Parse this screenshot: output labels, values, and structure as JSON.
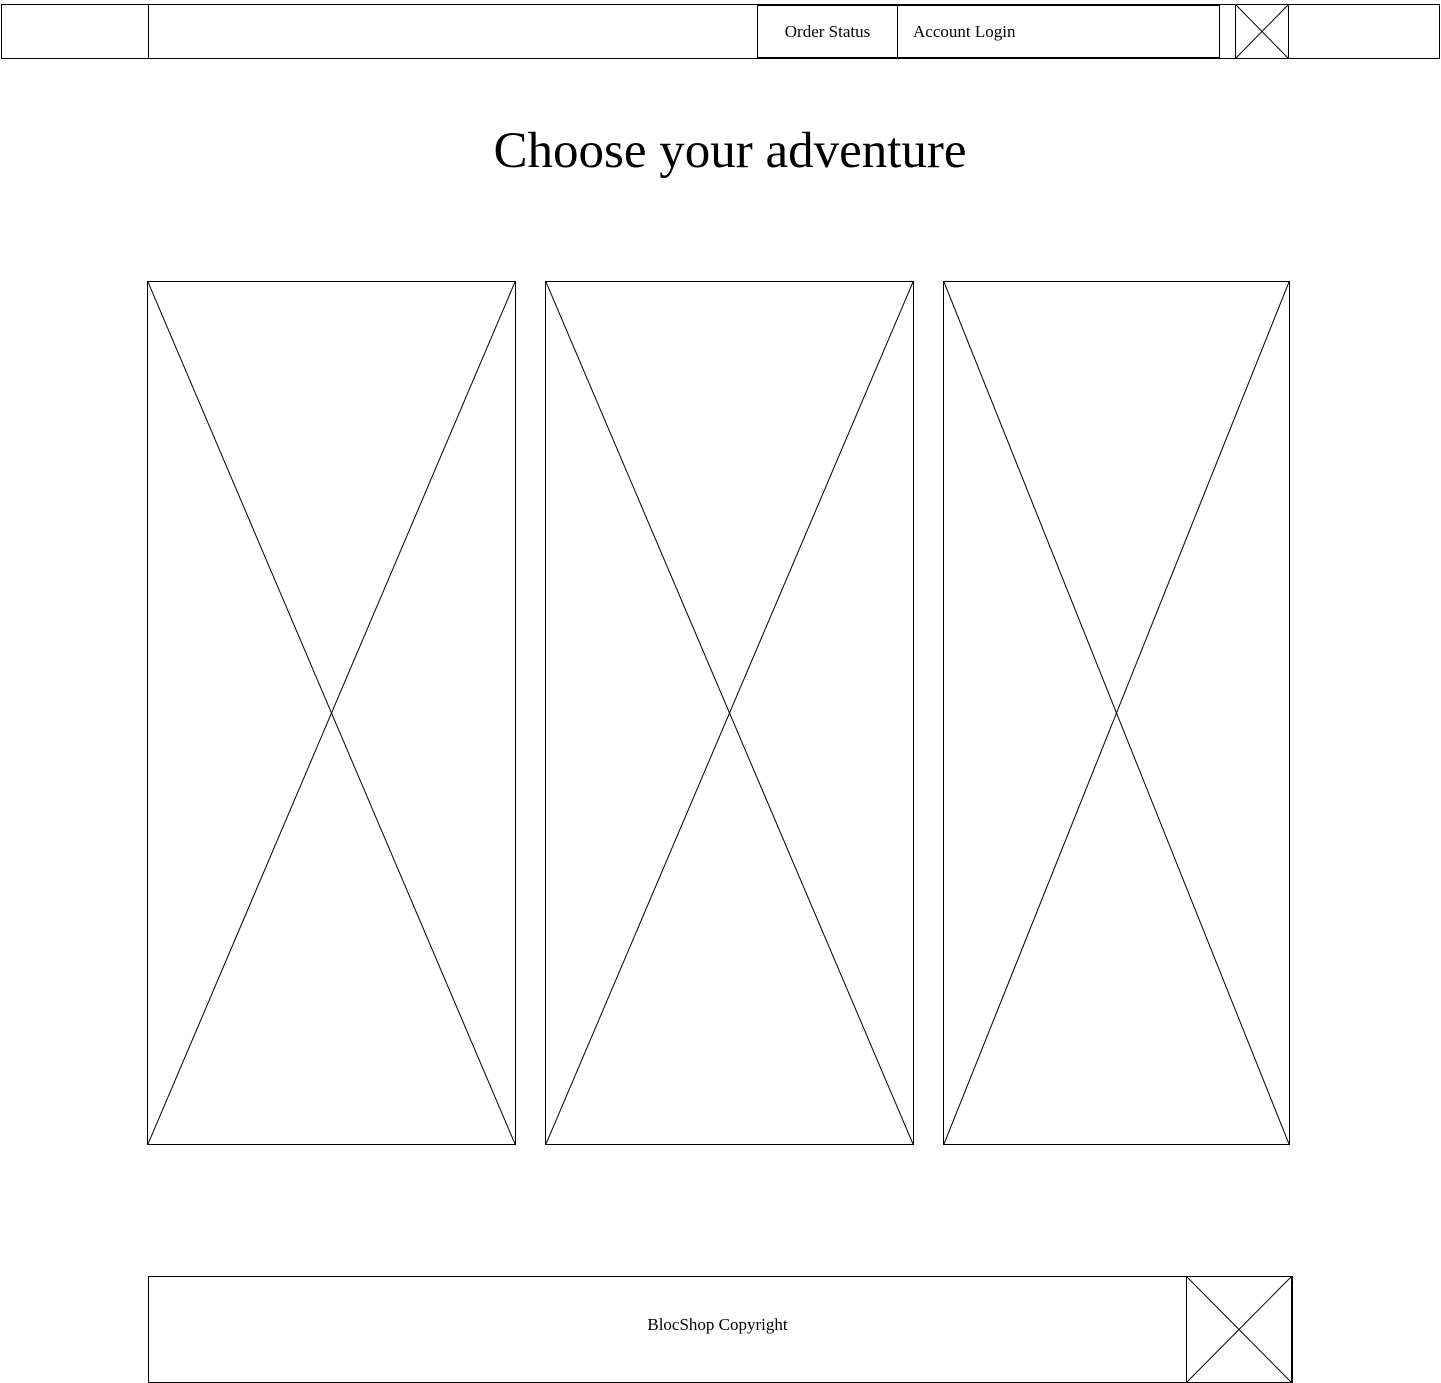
{
  "header": {
    "nav": [
      {
        "label": "Order Status"
      },
      {
        "label": "Account Login"
      }
    ],
    "logo_icon": "image-placeholder-icon"
  },
  "main": {
    "title": "Choose your adventure",
    "cards": [
      {
        "icon": "image-placeholder-icon"
      },
      {
        "icon": "image-placeholder-icon"
      },
      {
        "icon": "image-placeholder-icon"
      }
    ]
  },
  "footer": {
    "copyright": "BlocShop Copyright",
    "icon": "image-placeholder-icon"
  }
}
